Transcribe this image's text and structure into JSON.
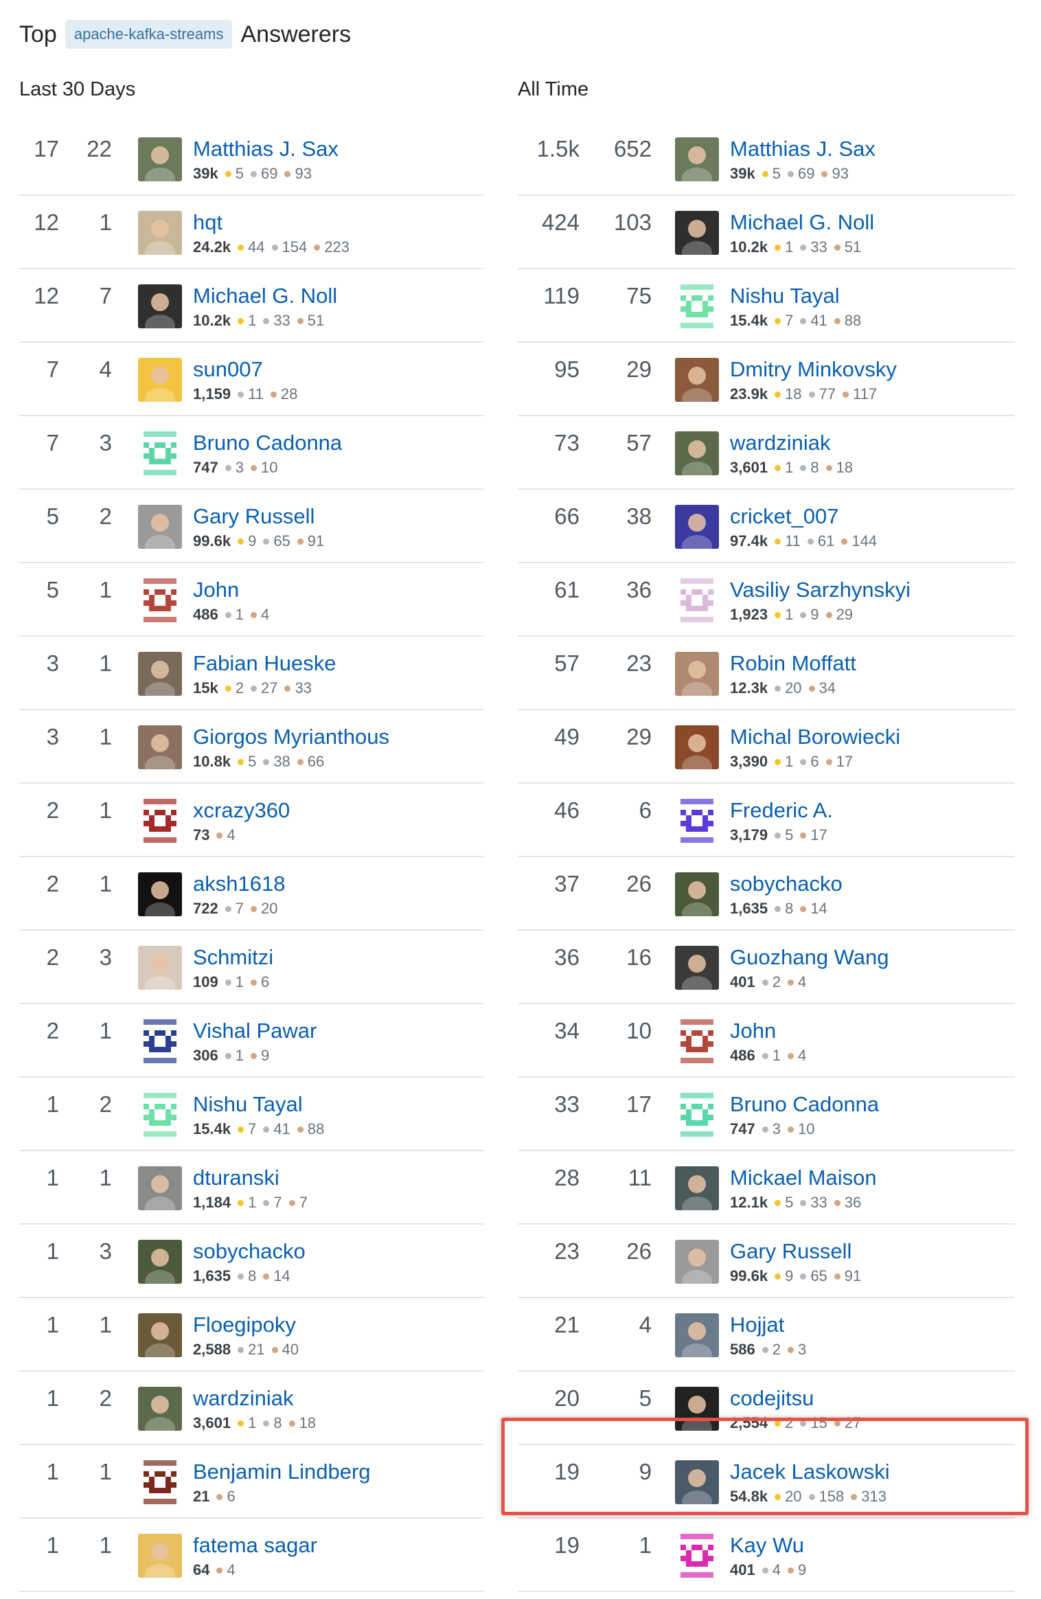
{
  "header": {
    "prefix": "Top",
    "tag": "apache-kafka-streams",
    "suffix": "Answerers"
  },
  "columns": {
    "last30": "Last 30 Days",
    "alltime": "All Time"
  },
  "colors": {
    "link": "#0a5fb0",
    "highlight": "#e8514a",
    "gold": "#f4c430",
    "silver": "#b4b8bc",
    "bronze": "#d1a684"
  },
  "last30": [
    {
      "n1": "17",
      "n2": "22",
      "name": "Matthias J. Sax",
      "rep": "39k",
      "gold": "5",
      "silver": "69",
      "bronze": "93",
      "avatar": "photo",
      "c": "#6b7a5d"
    },
    {
      "n1": "12",
      "n2": "1",
      "name": "hqt",
      "rep": "24.2k",
      "gold": "44",
      "silver": "154",
      "bronze": "223",
      "avatar": "photo",
      "c": "#c7b89a"
    },
    {
      "n1": "12",
      "n2": "7",
      "name": "Michael G. Noll",
      "rep": "10.2k",
      "gold": "1",
      "silver": "33",
      "bronze": "51",
      "avatar": "photo",
      "c": "#2f2f2f"
    },
    {
      "n1": "7",
      "n2": "4",
      "name": "sun007",
      "rep": "1,159",
      "silver": "11",
      "bronze": "28",
      "avatar": "photo",
      "c": "#f5c342"
    },
    {
      "n1": "7",
      "n2": "3",
      "name": "Bruno Cadonna",
      "rep": "747",
      "silver": "3",
      "bronze": "10",
      "avatar": "identicon",
      "c": "#5bd6a8"
    },
    {
      "n1": "5",
      "n2": "2",
      "name": "Gary Russell",
      "rep": "99.6k",
      "gold": "9",
      "silver": "65",
      "bronze": "91",
      "avatar": "photo",
      "c": "#9a9a9a"
    },
    {
      "n1": "5",
      "n2": "1",
      "name": "John",
      "rep": "486",
      "silver": "1",
      "bronze": "4",
      "avatar": "identicon",
      "c": "#b5453a"
    },
    {
      "n1": "3",
      "n2": "1",
      "name": "Fabian Hueske",
      "rep": "15k",
      "gold": "2",
      "silver": "27",
      "bronze": "33",
      "avatar": "photo",
      "c": "#7a6a5a"
    },
    {
      "n1": "3",
      "n2": "1",
      "name": "Giorgos Myrianthous",
      "rep": "10.8k",
      "gold": "5",
      "silver": "38",
      "bronze": "66",
      "avatar": "photo",
      "c": "#8c7160"
    },
    {
      "n1": "2",
      "n2": "1",
      "name": "xcrazy360",
      "rep": "73",
      "bronze": "4",
      "avatar": "identicon",
      "c": "#a52a2a"
    },
    {
      "n1": "2",
      "n2": "1",
      "name": "aksh1618",
      "rep": "722",
      "silver": "7",
      "bronze": "20",
      "avatar": "photo",
      "c": "#111111"
    },
    {
      "n1": "2",
      "n2": "3",
      "name": "Schmitzi",
      "rep": "109",
      "silver": "1",
      "bronze": "6",
      "avatar": "photo",
      "c": "#d9c8bc"
    },
    {
      "n1": "2",
      "n2": "1",
      "name": "Vishal Pawar",
      "rep": "306",
      "silver": "1",
      "bronze": "9",
      "avatar": "identicon",
      "c": "#2a3f8f"
    },
    {
      "n1": "1",
      "n2": "2",
      "name": "Nishu Tayal",
      "rep": "15.4k",
      "gold": "7",
      "silver": "41",
      "bronze": "88",
      "avatar": "identicon",
      "c": "#6fe0a8"
    },
    {
      "n1": "1",
      "n2": "1",
      "name": "dturanski",
      "rep": "1,184",
      "gold": "1",
      "silver": "7",
      "bronze": "7",
      "avatar": "photo",
      "c": "#8a8a8a"
    },
    {
      "n1": "1",
      "n2": "3",
      "name": "sobychacko",
      "rep": "1,635",
      "silver": "8",
      "bronze": "14",
      "avatar": "photo",
      "c": "#4a5a3a"
    },
    {
      "n1": "1",
      "n2": "1",
      "name": "Floegipoky",
      "rep": "2,588",
      "silver": "21",
      "bronze": "40",
      "avatar": "photo",
      "c": "#6a5a3a"
    },
    {
      "n1": "1",
      "n2": "2",
      "name": "wardziniak",
      "rep": "3,601",
      "gold": "1",
      "silver": "8",
      "bronze": "18",
      "avatar": "photo",
      "c": "#5a6a4a"
    },
    {
      "n1": "1",
      "n2": "1",
      "name": "Benjamin Lindberg",
      "rep": "21",
      "bronze": "6",
      "avatar": "identicon",
      "c": "#7a2a1a"
    },
    {
      "n1": "1",
      "n2": "1",
      "name": "fatema sagar",
      "rep": "64",
      "bronze": "4",
      "avatar": "photo",
      "c": "#e8c060"
    }
  ],
  "alltime": [
    {
      "n1": "1.5k",
      "n2": "652",
      "name": "Matthias J. Sax",
      "rep": "39k",
      "gold": "5",
      "silver": "69",
      "bronze": "93",
      "avatar": "photo",
      "c": "#6b7a5d"
    },
    {
      "n1": "424",
      "n2": "103",
      "name": "Michael G. Noll",
      "rep": "10.2k",
      "gold": "1",
      "silver": "33",
      "bronze": "51",
      "avatar": "photo",
      "c": "#2f2f2f"
    },
    {
      "n1": "119",
      "n2": "75",
      "name": "Nishu Tayal",
      "rep": "15.4k",
      "gold": "7",
      "silver": "41",
      "bronze": "88",
      "avatar": "identicon",
      "c": "#6fe0a8"
    },
    {
      "n1": "95",
      "n2": "29",
      "name": "Dmitry Minkovsky",
      "rep": "23.9k",
      "gold": "18",
      "silver": "77",
      "bronze": "117",
      "avatar": "photo",
      "c": "#8a5a3a"
    },
    {
      "n1": "73",
      "n2": "57",
      "name": "wardziniak",
      "rep": "3,601",
      "gold": "1",
      "silver": "8",
      "bronze": "18",
      "avatar": "photo",
      "c": "#5a6a4a"
    },
    {
      "n1": "66",
      "n2": "38",
      "name": "cricket_007",
      "rep": "97.4k",
      "gold": "11",
      "silver": "61",
      "bronze": "144",
      "avatar": "photo",
      "c": "#3a3aa0"
    },
    {
      "n1": "61",
      "n2": "36",
      "name": "Vasiliy Sarzhynskyi",
      "rep": "1,923",
      "gold": "1",
      "silver": "9",
      "bronze": "29",
      "avatar": "identicon",
      "c": "#d9b8d9"
    },
    {
      "n1": "57",
      "n2": "23",
      "name": "Robin Moffatt",
      "rep": "12.3k",
      "silver": "20",
      "bronze": "34",
      "avatar": "photo",
      "c": "#b08a70"
    },
    {
      "n1": "49",
      "n2": "29",
      "name": "Michal Borowiecki",
      "rep": "3,390",
      "gold": "1",
      "silver": "6",
      "bronze": "17",
      "avatar": "photo",
      "c": "#8a4a2a"
    },
    {
      "n1": "46",
      "n2": "6",
      "name": "Frederic A.",
      "rep": "3,179",
      "silver": "5",
      "bronze": "17",
      "avatar": "identicon",
      "c": "#5a3ad9"
    },
    {
      "n1": "37",
      "n2": "26",
      "name": "sobychacko",
      "rep": "1,635",
      "silver": "8",
      "bronze": "14",
      "avatar": "photo",
      "c": "#4a5a3a"
    },
    {
      "n1": "36",
      "n2": "16",
      "name": "Guozhang Wang",
      "rep": "401",
      "silver": "2",
      "bronze": "4",
      "avatar": "photo",
      "c": "#3a3a3a"
    },
    {
      "n1": "34",
      "n2": "10",
      "name": "John",
      "rep": "486",
      "silver": "1",
      "bronze": "4",
      "avatar": "identicon",
      "c": "#b5453a"
    },
    {
      "n1": "33",
      "n2": "17",
      "name": "Bruno Cadonna",
      "rep": "747",
      "silver": "3",
      "bronze": "10",
      "avatar": "identicon",
      "c": "#5bd6a8"
    },
    {
      "n1": "28",
      "n2": "11",
      "name": "Mickael Maison",
      "rep": "12.1k",
      "gold": "5",
      "silver": "33",
      "bronze": "36",
      "avatar": "photo",
      "c": "#4a5a5a"
    },
    {
      "n1": "23",
      "n2": "26",
      "name": "Gary Russell",
      "rep": "99.6k",
      "gold": "9",
      "silver": "65",
      "bronze": "91",
      "avatar": "photo",
      "c": "#9a9a9a"
    },
    {
      "n1": "21",
      "n2": "4",
      "name": "Hojjat",
      "rep": "586",
      "silver": "2",
      "bronze": "3",
      "avatar": "photo",
      "c": "#6a7a8a"
    },
    {
      "n1": "20",
      "n2": "5",
      "name": "codejitsu",
      "rep": "2,554",
      "gold": "2",
      "silver": "15",
      "bronze": "27",
      "avatar": "photo",
      "c": "#222222"
    },
    {
      "n1": "19",
      "n2": "9",
      "name": "Jacek Laskowski",
      "rep": "54.8k",
      "gold": "20",
      "silver": "158",
      "bronze": "313",
      "avatar": "photo",
      "c": "#4a5a6a"
    },
    {
      "n1": "19",
      "n2": "1",
      "name": "Kay Wu",
      "rep": "401",
      "silver": "4",
      "bronze": "9",
      "avatar": "identicon",
      "c": "#d92ab0"
    }
  ]
}
